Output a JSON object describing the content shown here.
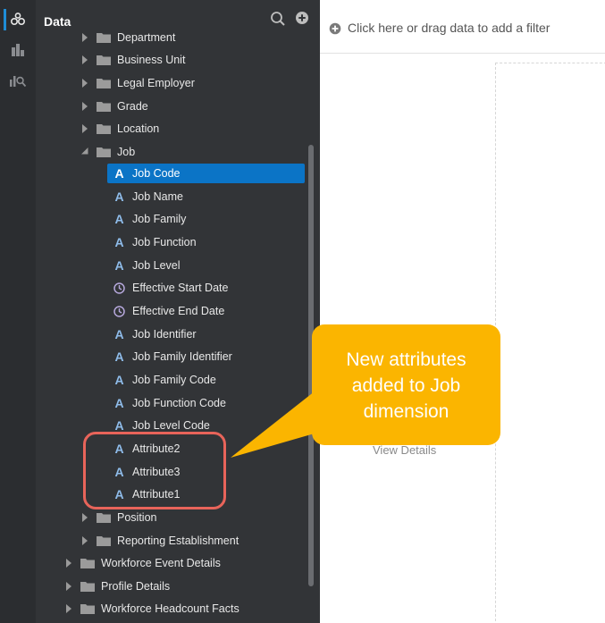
{
  "rail": {
    "items": [
      {
        "icon": "data-icon",
        "active": true
      },
      {
        "icon": "visualizations-icon",
        "active": false
      },
      {
        "icon": "analytics-icon",
        "active": false
      }
    ]
  },
  "panel": {
    "title": "Data",
    "search_icon": "search-icon",
    "add_icon": "add-icon"
  },
  "tree": {
    "department": "Department",
    "business_unit": "Business Unit",
    "legal_employer": "Legal Employer",
    "grade": "Grade",
    "location": "Location",
    "job": "Job",
    "job_children": [
      {
        "label": "Job Code",
        "type": "attribute",
        "selected": true
      },
      {
        "label": "Job Name",
        "type": "attribute"
      },
      {
        "label": "Job Family",
        "type": "attribute"
      },
      {
        "label": "Job Function",
        "type": "attribute"
      },
      {
        "label": "Job Level",
        "type": "attribute"
      },
      {
        "label": "Effective Start Date",
        "type": "date"
      },
      {
        "label": "Effective End Date",
        "type": "date"
      },
      {
        "label": "Job Identifier",
        "type": "attribute"
      },
      {
        "label": "Job Family Identifier",
        "type": "attribute"
      },
      {
        "label": "Job Family Code",
        "type": "attribute"
      },
      {
        "label": "Job Function Code",
        "type": "attribute"
      },
      {
        "label": "Job Level Code",
        "type": "attribute"
      },
      {
        "label": "Attribute2",
        "type": "attribute"
      },
      {
        "label": "Attribute3",
        "type": "attribute"
      },
      {
        "label": "Attribute1",
        "type": "attribute"
      }
    ],
    "position": "Position",
    "reporting_establishment": "Reporting Establishment",
    "workforce_event_details": "Workforce Event Details",
    "profile_details": "Profile Details",
    "workforce_headcount_facts": "Workforce Headcount Facts"
  },
  "filter_bar": {
    "text": "Click here or drag data to add a filter"
  },
  "canvas": {
    "view_details": "View Details"
  },
  "callout": {
    "text": "New attributes added to Job dimension"
  },
  "colors": {
    "panel_bg": "#323437",
    "rail_bg": "#2b2d30",
    "selection": "#0b74c6",
    "callout": "#fbb500",
    "highlight": "#e8645a"
  }
}
